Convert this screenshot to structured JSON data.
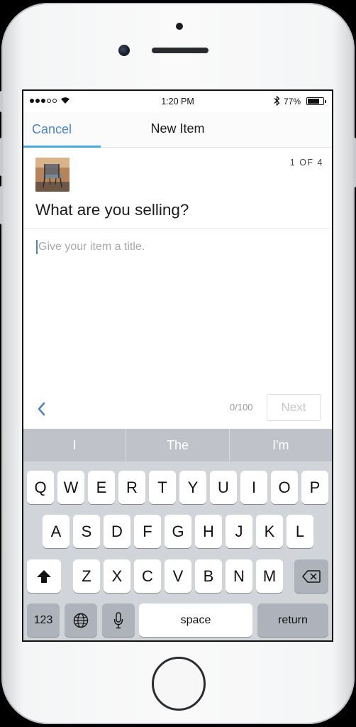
{
  "status_bar": {
    "time": "1:20 PM",
    "battery": "77%",
    "battery_level": 0.77
  },
  "nav": {
    "cancel_label": "Cancel",
    "title": "New Item",
    "progress_fraction": 0.25
  },
  "form": {
    "step": "1 OF 4",
    "question": "What are you selling?",
    "title_placeholder": "Give your item a title.",
    "title_value": "",
    "char_count": "0/100",
    "next_label": "Next"
  },
  "keyboard": {
    "suggestions": [
      "I",
      "The",
      "I'm"
    ],
    "row1": [
      "Q",
      "W",
      "E",
      "R",
      "T",
      "Y",
      "U",
      "I",
      "O",
      "P"
    ],
    "row2": [
      "A",
      "S",
      "D",
      "F",
      "G",
      "H",
      "J",
      "K",
      "L"
    ],
    "row3": [
      "Z",
      "X",
      "C",
      "V",
      "B",
      "N",
      "M"
    ],
    "numbers_label": "123",
    "space_label": "space",
    "return_label": "return"
  },
  "colors": {
    "accent": "#4a83c8",
    "progress": "#49a9dc",
    "keyboard_bg": "#d1d4d9",
    "suggestion_bar": "#bfc3c9"
  }
}
